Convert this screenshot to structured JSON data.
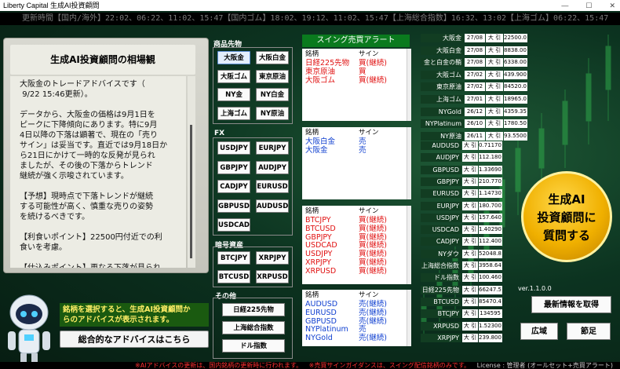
{
  "window": {
    "title": "Liberty Capital 生成AI投資顧問",
    "buttons": [
      "—",
      "☐",
      "✕"
    ]
  },
  "ticker": "更新時間【国内/海外】22:02、06:22、11:02、15:47【国内ゴム】18:02、19:12、11:02、15:47【上海総合指数】16:32、13:02【上海ゴム】06:22、15:47",
  "advisor": {
    "title": "生成AI投資顧問の相場観",
    "text": "大阪金のトレードアドバイスです（\n 9/22 15:46更新）。\n\nデータから、大阪金の価格は9月1日を\nピークに下降傾向にあります。特に9月\n4日以降の下落は顕著で、現在の「売り\nサイン」は妥当です。直近では9月18日か\nら21日にかけて一時的な反発が見られ\nましたが、その後の下落からトレンド\n継続が強く示唆されています。\n\n【予想】現時点で下落トレンドが継続\nする可能性が高く、慎重な売りの姿勢\nを続けるべきです。\n\n【利食いポイント】22500円付近での利\n食いを考慮。\n\n【仕込みポイント】更なる下落が見られ\nた場合、22000円付近で新たな売りポ\nジションの検討を。"
  },
  "hint": "銘柄を選択すると、生成AI投資顧問か\nらのアドバイスが表示されます。",
  "overall_button": "総合的なアドバイスはこちら",
  "groups": {
    "commodity": {
      "label": "商品先物",
      "buttons": [
        "大阪金",
        "大阪白金",
        "大阪ゴム",
        "東京原油",
        "NY金",
        "NY白金",
        "上海ゴム",
        "NY原油"
      ]
    },
    "fx": {
      "label": "FX",
      "buttons": [
        "USDJPY",
        "EURJPY",
        "GBPJPY",
        "AUDJPY",
        "CADJPY",
        "EURUSD",
        "GBPUSD",
        "AUDUSD",
        "USDCAD"
      ]
    },
    "crypto": {
      "label": "暗号資産",
      "buttons": [
        "BTCJPY",
        "XRPJPY",
        "BTCUSD",
        "XRPUSD"
      ]
    },
    "other": {
      "label": "その他",
      "buttons": [
        "日経225先物",
        "上海総合指数",
        "ドル指数"
      ]
    }
  },
  "swing": {
    "header": "スイング売買アラート",
    "col_name": "銘柄",
    "col_sign": "サイン",
    "boxes": [
      {
        "rows": [
          [
            "日経225先物",
            "買(継続)",
            "red"
          ],
          [
            "東京原油",
            "買",
            "red"
          ],
          [
            "大阪ゴム",
            "買(継続)",
            "red"
          ]
        ]
      },
      {
        "rows": [
          [
            "大阪白金",
            "売",
            "blue"
          ],
          [
            "大阪金",
            "売",
            "blue"
          ]
        ]
      },
      {
        "rows": [
          [
            "BTCJPY",
            "買(継続)",
            "red"
          ],
          [
            "BTCUSD",
            "買(継続)",
            "red"
          ],
          [
            "GBPJPY",
            "買(継続)",
            "red"
          ],
          [
            "USDCAD",
            "買(継続)",
            "red"
          ],
          [
            "USDJPY",
            "買(継続)",
            "red"
          ],
          [
            "XRPJPY",
            "買(継続)",
            "red"
          ],
          [
            "XRPUSD",
            "買(継続)",
            "red"
          ]
        ]
      },
      {
        "rows": [
          [
            "AUDUSD",
            "売(継続)",
            "blue"
          ],
          [
            "EURUSD",
            "売(継続)",
            "blue"
          ],
          [
            "GBPUSD",
            "売(継続)",
            "blue"
          ],
          [
            "NYPlatinum",
            "売",
            "blue"
          ],
          [
            "NYGold",
            "売(継続)",
            "blue"
          ]
        ]
      }
    ]
  },
  "prices_dated": [
    [
      "大阪金",
      "27/08",
      "大 引",
      "22500.0"
    ],
    [
      "大阪白金",
      "27/08",
      "大 引",
      "8838.00"
    ],
    [
      "金と白金の鞘",
      "27/08",
      "大 引",
      "6338.00"
    ],
    [
      "大阪ゴム",
      "27/02",
      "大 引",
      "439.900"
    ],
    [
      "東京原油",
      "27/02",
      "大 引",
      "84520.0"
    ],
    [
      "上海ゴム",
      "27/01",
      "大 引",
      "18965.0"
    ],
    [
      "NYGold",
      "26/12",
      "大 引",
      "4359.35"
    ],
    [
      "NYPlatinum",
      "26/10",
      "大 引",
      "1780.50"
    ],
    [
      "NY原油",
      "26/11",
      "大 引",
      "93.5500"
    ]
  ],
  "prices": [
    [
      "AUDUSD",
      "大 引",
      "0.71170"
    ],
    [
      "AUDJPY",
      "大 引",
      "112.180"
    ],
    [
      "GBPUSD",
      "大 引",
      "1.33690"
    ],
    [
      "GBPJPY",
      "大 引",
      "210.770"
    ],
    [
      "EURUSD",
      "大 引",
      "1.14730"
    ],
    [
      "EURJPY",
      "大 引",
      "180.700"
    ],
    [
      "USDJPY",
      "大 引",
      "157.640"
    ],
    [
      "USDCAD",
      "大 引",
      "1.40290"
    ],
    [
      "CADJPY",
      "大 引",
      "112.400"
    ],
    [
      "NYダウ",
      "大 引",
      "52048.8"
    ],
    [
      "上海総合指数",
      "大 引",
      "3958.64"
    ],
    [
      "ドル指数",
      "大 引",
      "100.460"
    ],
    [
      "日経225先物",
      "大 引",
      "66247.5"
    ],
    [
      "BTCUSD",
      "大 引",
      "85470.4"
    ],
    [
      "BTCJPY",
      "大 引",
      "134595"
    ],
    [
      "XRPUSD",
      "大 引",
      "1.52300"
    ],
    [
      "XRPJPY",
      "大 引",
      "239.800"
    ]
  ],
  "circle": {
    "line1": "生成AI",
    "line2": "投資顧問に",
    "line3": "質問する"
  },
  "version": "ver.1.1.0.0",
  "buttons": {
    "latest": "最新情報を取得",
    "wide": "広域",
    "adjust": "節足"
  },
  "footer": {
    "left": "※AIアドバイスの更新は、国内銘柄の更新時に行われます。",
    "mid": "※売買サインガイダンスは、スイング配信銘柄のみです。",
    "right": "License : 管理者 (オールセット+売買アラート)"
  },
  "colors": {
    "accent": "#0a7a1e",
    "buy": "#e01010",
    "sell": "#1040d0",
    "circle": "#f0b000"
  }
}
